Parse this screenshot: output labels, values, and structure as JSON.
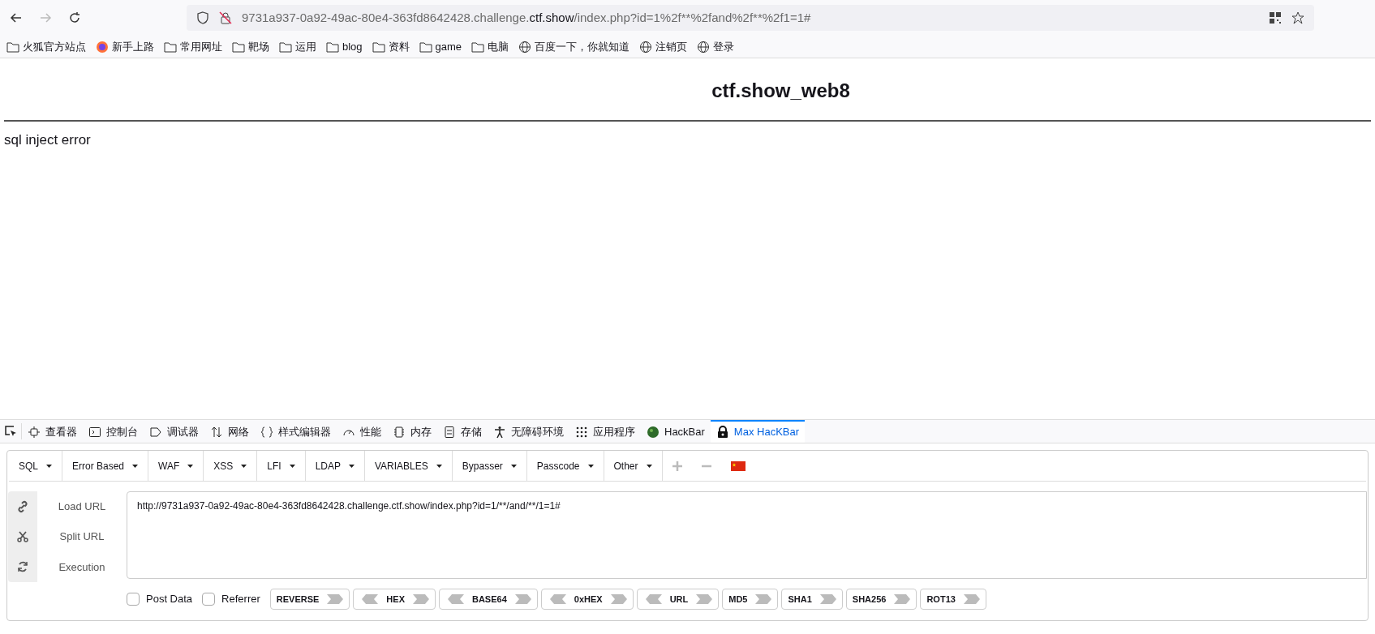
{
  "browser": {
    "url": {
      "host": "9731a937-0a92-49ac-80e4-363fd8642428.challenge.",
      "domain": "ctf.show",
      "path": "/index.php?id=1%2f**%2fand%2f**%2f1=1#"
    }
  },
  "bookmarks": [
    {
      "kind": "folder",
      "label": "火狐官方站点"
    },
    {
      "kind": "firefox",
      "label": "新手上路"
    },
    {
      "kind": "folder",
      "label": "常用网址"
    },
    {
      "kind": "folder",
      "label": "靶场"
    },
    {
      "kind": "folder",
      "label": "运用"
    },
    {
      "kind": "folder",
      "label": "blog"
    },
    {
      "kind": "folder",
      "label": "资料"
    },
    {
      "kind": "folder",
      "label": "game"
    },
    {
      "kind": "folder",
      "label": "电脑"
    },
    {
      "kind": "globe",
      "label": "百度一下，你就知道"
    },
    {
      "kind": "globe",
      "label": "注销页"
    },
    {
      "kind": "globe",
      "label": "登录"
    }
  ],
  "page": {
    "title": "ctf.show_web8",
    "message": "sql inject error"
  },
  "devtools": {
    "tabs": [
      {
        "label": "查看器",
        "selected": false
      },
      {
        "label": "控制台",
        "selected": false
      },
      {
        "label": "调试器",
        "selected": false
      },
      {
        "label": "网络",
        "selected": false
      },
      {
        "label": "样式编辑器",
        "selected": false
      },
      {
        "label": "性能",
        "selected": false
      },
      {
        "label": "内存",
        "selected": false
      },
      {
        "label": "存储",
        "selected": false
      },
      {
        "label": "无障碍环境",
        "selected": false
      },
      {
        "label": "应用程序",
        "selected": false
      },
      {
        "label": "HackBar",
        "selected": false
      },
      {
        "label": "Max HacKBar",
        "selected": true
      }
    ]
  },
  "hackbar": {
    "menus": [
      "SQL",
      "Error Based",
      "WAF",
      "XSS",
      "LFI",
      "LDAP",
      "VARIABLES",
      "Bypasser",
      "Passcode",
      "Other"
    ],
    "actions": [
      "Load URL",
      "Split URL",
      "Execution"
    ],
    "url_value": "http://9731a937-0a92-49ac-80e4-363fd8642428.challenge.ctf.show/index.php?id=1/**/and/**/1=1#",
    "options": [
      {
        "label": "Post Data",
        "checked": false
      },
      {
        "label": "Referrer",
        "checked": false
      }
    ],
    "encoders": [
      {
        "label": "REVERSE",
        "kind": "right"
      },
      {
        "label": "HEX",
        "kind": "both"
      },
      {
        "label": "BASE64",
        "kind": "both"
      },
      {
        "label": "0xHEX",
        "kind": "both"
      },
      {
        "label": "URL",
        "kind": "both"
      },
      {
        "label": "MD5",
        "kind": "right"
      },
      {
        "label": "SHA1",
        "kind": "right"
      },
      {
        "label": "SHA256",
        "kind": "right"
      },
      {
        "label": "ROT13",
        "kind": "right"
      }
    ]
  }
}
